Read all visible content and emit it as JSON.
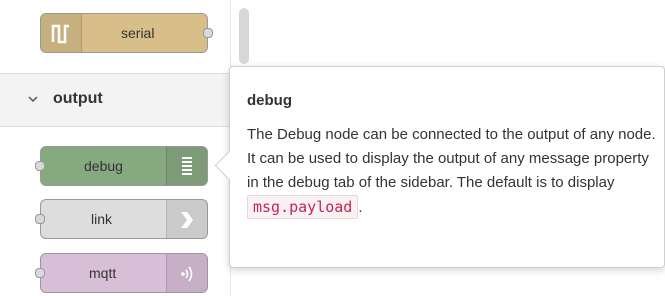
{
  "palette": {
    "category": {
      "label": "output",
      "icon": "chevron-down-icon"
    },
    "nodes": [
      {
        "id": "serial",
        "label": "serial",
        "icon": "serial-wave-icon",
        "color": "#d8bf8a"
      },
      {
        "id": "debug",
        "label": "debug",
        "icon": "debug-list-icon",
        "color": "#87a980"
      },
      {
        "id": "link",
        "label": "link",
        "icon": "link-out-arrow-icon",
        "color": "#dddddd"
      },
      {
        "id": "mqtt",
        "label": "mqtt",
        "icon": "mqtt-signal-icon",
        "color": "#d8bfd8"
      }
    ]
  },
  "tooltip": {
    "title": "debug",
    "body_prefix": "The Debug node can be connected to the output of any node. It can be used to display the output of any message property in the debug tab of the sidebar. The default is to display ",
    "code": "msg.payload",
    "body_suffix": "."
  }
}
